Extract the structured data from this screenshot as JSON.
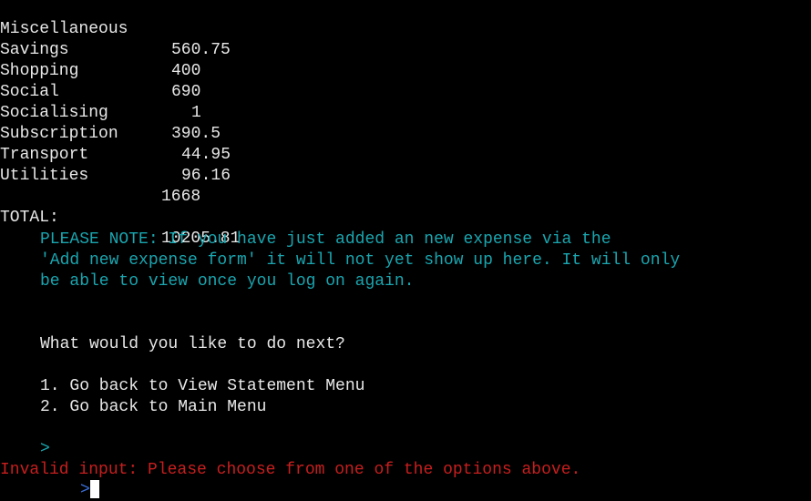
{
  "colors": {
    "background": "#000000",
    "text": "#e8e8e8",
    "note": "#19a6b0",
    "error": "#c81e1e",
    "prompt": "#3a6fd8"
  },
  "statement": {
    "rows": [
      {
        "category": "Miscellaneous",
        "amount": "560.75"
      },
      {
        "category": "Savings",
        "amount": "400"
      },
      {
        "category": "Shopping",
        "amount": "690"
      },
      {
        "category": "Social",
        "amount": "1"
      },
      {
        "category": "Socialising",
        "amount": "390.5"
      },
      {
        "category": "Subscription",
        "amount": "44.95"
      },
      {
        "category": "Transport",
        "amount": "96.16"
      },
      {
        "category": "Utilities",
        "amount": "1668"
      }
    ],
    "total_label": "TOTAL:",
    "total_value": "10205.81"
  },
  "note": {
    "line1": "PLEASE NOTE: If you have just added an new expense via the",
    "line2": "'Add new expense form' it will not yet show up here. It will only",
    "line3": "be able to view once you log on again."
  },
  "menu": {
    "question": "What would you like to do next?",
    "option1": "1. Go back to View Statement Menu",
    "option2": "2. Go back to Main Menu"
  },
  "prompt": {
    "symbol": ">",
    "error": "Invalid input: Please choose from one of the options above.",
    "second_symbol": ">"
  }
}
